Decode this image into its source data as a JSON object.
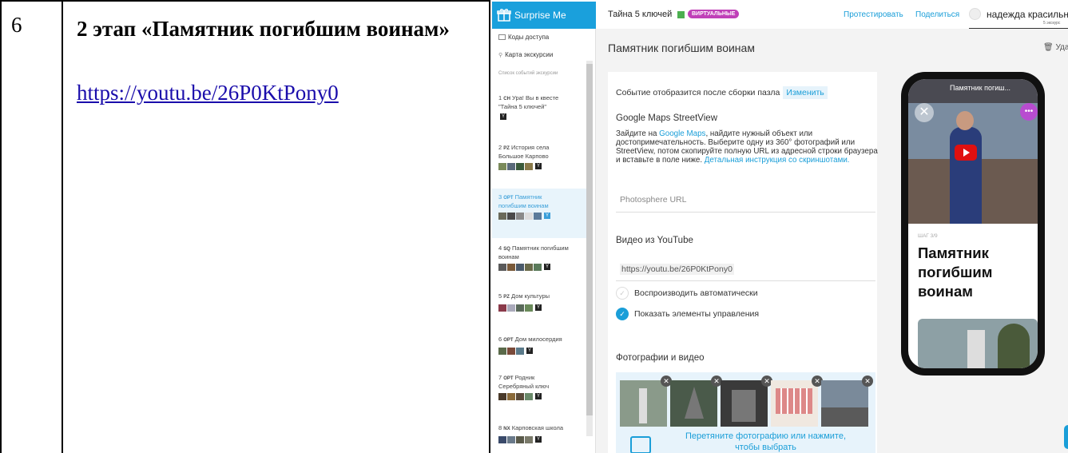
{
  "document": {
    "row_number": "6",
    "stage_title": "2 этап «Памятник погибшим воинам»",
    "link": "https://youtu.be/26P0KtPony0"
  },
  "app": {
    "brand": "Surprise Me",
    "quest_title": "Тайна 5 ключей",
    "virtual_badge": "ВИРТУАЛЬНЫЕ",
    "test_link": "Протестировать",
    "share_link": "Поделиться",
    "user_name": "надежда красильни",
    "user_sub": "5 экскурс",
    "page_title": "Памятник погибшим воинам",
    "delete_label": "Уда",
    "sidebar": {
      "access_codes": "Коды доступа",
      "tour_map": "Карта экскурсии",
      "list_label": "Список событий экскурсии",
      "events": [
        {
          "num": "1",
          "code": "СН",
          "name": "Ура! Вы в квесте \"Тайна 5 ключей\""
        },
        {
          "num": "2",
          "code": "PZ",
          "name": "История села Большое Карпово"
        },
        {
          "num": "3",
          "code": "ОРТ",
          "name": "Памятник погибшим воинам"
        },
        {
          "num": "4",
          "code": "SQ",
          "name": "Памятник погибшим воинам"
        },
        {
          "num": "5",
          "code": "PZ",
          "name": "Дом культуры"
        },
        {
          "num": "6",
          "code": "ОРТ",
          "name": "Дом милосердия"
        },
        {
          "num": "7",
          "code": "ОРТ",
          "name": "Родник Серебряный ключ"
        },
        {
          "num": "8",
          "code": "NX",
          "name": "Карповская школа"
        }
      ]
    },
    "form": {
      "after_puzzle": "Событие отобразится после сборки пазла",
      "change_btn": "Изменить",
      "gm_title": "Google Maps StreetView",
      "gm_text_1": "Зайдите на ",
      "gm_link": "Google Maps",
      "gm_text_2": ", найдите нужный объект или достопримечательность. Выберите одну из 360° фотографий или StreetView, потом скопируйте полную URL из адресной строки браузера и вставьте в поле ниже. ",
      "gm_instr": "Детальная инструкция со скриншотами.",
      "photosphere_placeholder": "Photosphere URL",
      "yt_title": "Видео из YouTube",
      "yt_value": "https://youtu.be/26P0KtPony0",
      "autoplay": "Воспроизводить автоматически",
      "autoplay_checked": false,
      "show_controls": "Показать элементы управления",
      "show_controls_checked": true,
      "photos_title": "Фотографии и видео",
      "drop_text": "Перетяните фотографию или нажмите, чтобы выбрать"
    },
    "phone": {
      "video_title": "Памятник погиш...",
      "step_label": "ШАГ 3/9",
      "title": "Памятник погибшим воинам"
    },
    "colors": {
      "brand": "#1aa0dc",
      "accent": "#1a9ed8",
      "badge": "#c040b8",
      "active_bg": "#e8f4fb"
    }
  }
}
